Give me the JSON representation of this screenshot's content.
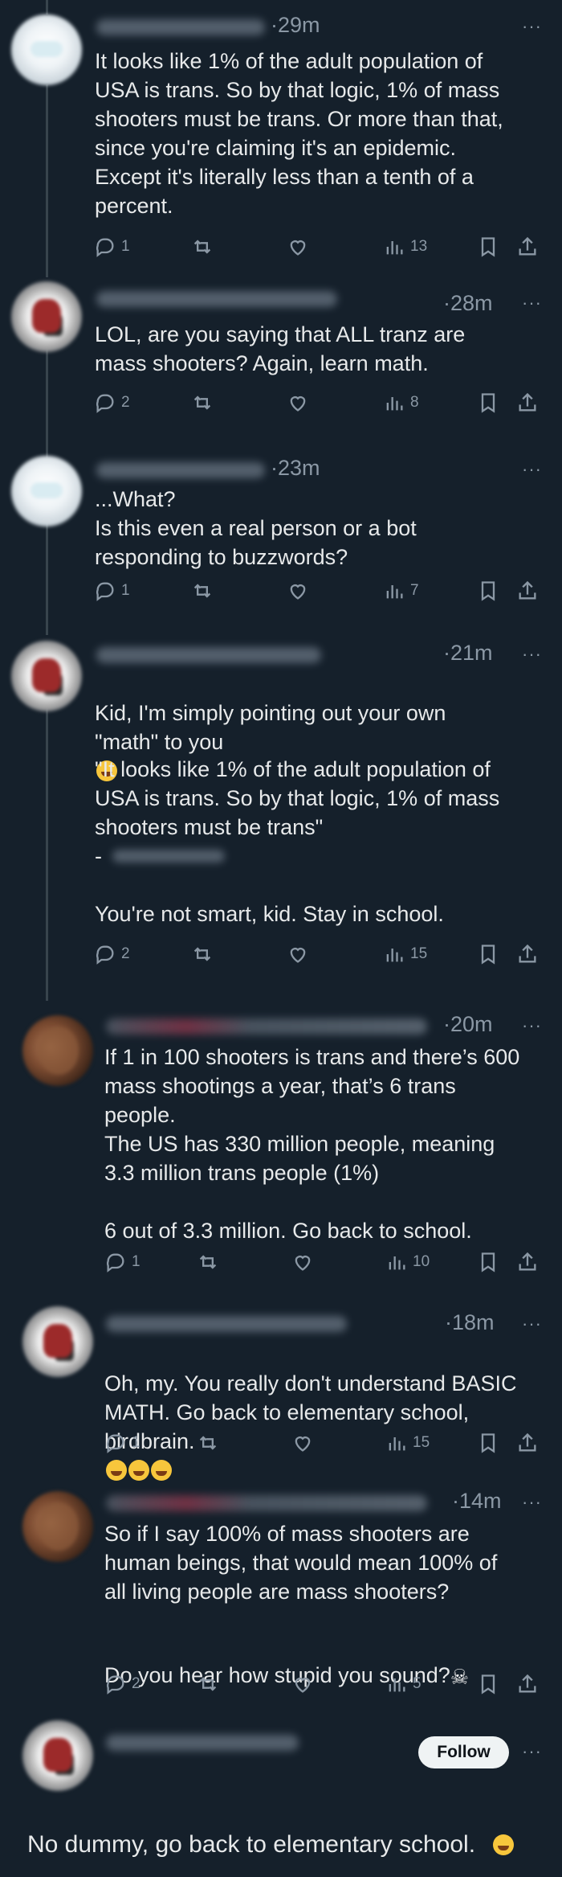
{
  "tweets": [
    {
      "time": "·29m",
      "text": "It looks like 1% of the adult population of\nUSA is trans. So by that logic, 1% of mass\nshooters must be trans. Or more than that,\nsince you're claiming it's an epidemic.\nExcept it's literally less than a tenth of a\npercent.",
      "replies": "1",
      "views": "13"
    },
    {
      "time": "·28m",
      "text": "LOL, are you saying that ALL tranz are\nmass shooters?  Again, learn math.",
      "replies": "2",
      "views": "8"
    },
    {
      "time": "·23m",
      "text": "...What?\nIs this even a real person or a bot\nresponding to buzzwords?",
      "replies": "1",
      "views": "7"
    },
    {
      "time": "·21m",
      "text_a": "Kid, I'm simply pointing out your own\n\"math\" to you",
      "text_b": "\"It looks like 1% of the adult population of\nUSA is trans. So by that logic, 1% of mass\nshooters must be trans\"\n-\n\nYou're not smart, kid.  Stay in school.",
      "replies": "2",
      "views": "15"
    },
    {
      "time": "·20m",
      "text": "If 1 in 100 shooters is trans and there’s 600\nmass shootings a year, that’s 6 trans\npeople.\nThe US has 330 million people, meaning\n3.3 million trans people (1%)\n\n6 out of 3.3 million. Go back to school.",
      "replies": "1",
      "views": "10"
    },
    {
      "time": "·18m",
      "text": "Oh, my.  You really don't understand BASIC\nMATH.  Go back to elementary school,\nbirdbrain.",
      "replies": "1",
      "views": "15"
    },
    {
      "time": "·14m",
      "text_a": "So if I say 100% of mass shooters are\nhuman beings, that would mean 100% of\nall living people are mass shooters?",
      "text_b": "Do you hear how stupid you sound?",
      "replies": "2",
      "views": "5"
    }
  ],
  "follow_label": "Follow",
  "final_text": "No dummy, go back to elementary school.",
  "more_label": "···",
  "icons": {
    "reply": "reply-icon",
    "retweet": "retweet-icon",
    "like": "heart-icon",
    "views": "views-icon",
    "bookmark": "bookmark-icon",
    "share": "share-icon"
  },
  "colors": {
    "background": "#15202b",
    "text": "#e7e9ea",
    "muted": "#8b98a5",
    "follow_bg": "#eff3f4"
  }
}
